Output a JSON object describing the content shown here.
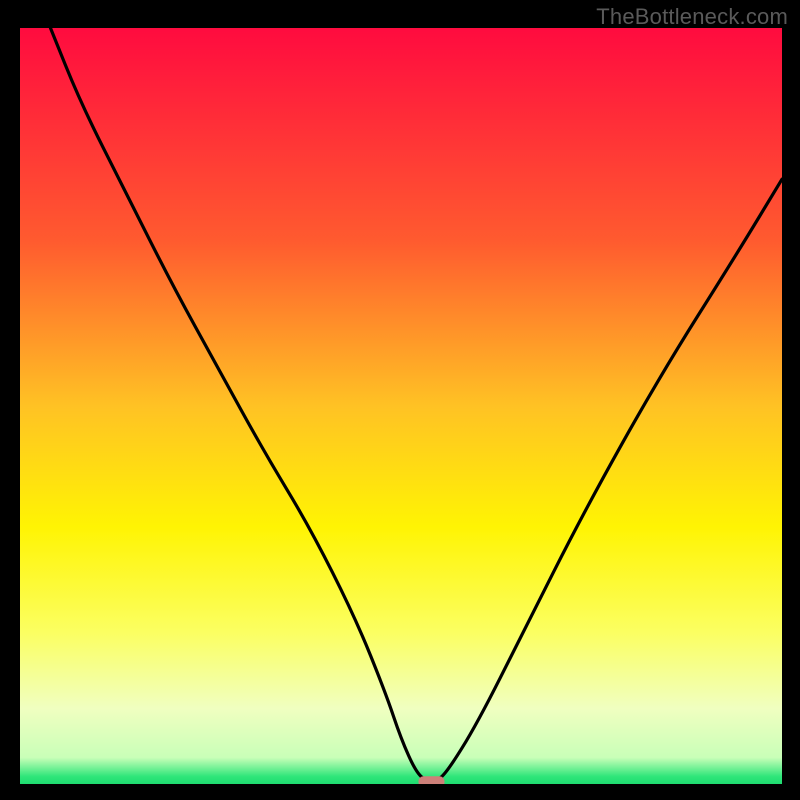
{
  "watermark": "TheBottleneck.com",
  "chart_data": {
    "type": "line",
    "title": "",
    "xlabel": "",
    "ylabel": "",
    "xlim": [
      0,
      100
    ],
    "ylim": [
      0,
      100
    ],
    "gradient_stops": [
      {
        "offset": 0.0,
        "color": "#ff0b3f"
      },
      {
        "offset": 0.28,
        "color": "#ff5a2f"
      },
      {
        "offset": 0.5,
        "color": "#ffc224"
      },
      {
        "offset": 0.66,
        "color": "#fff403"
      },
      {
        "offset": 0.8,
        "color": "#fbff62"
      },
      {
        "offset": 0.9,
        "color": "#f0ffc0"
      },
      {
        "offset": 0.965,
        "color": "#c9ffb8"
      },
      {
        "offset": 0.99,
        "color": "#2fe67a"
      },
      {
        "offset": 1.0,
        "color": "#1fdc70"
      }
    ],
    "series": [
      {
        "name": "bottleneck-curve",
        "x": [
          4,
          8,
          14,
          20,
          26,
          32,
          38,
          44,
          48,
          50,
          52,
          53.5,
          54.5,
          56,
          60,
          66,
          74,
          84,
          94,
          100
        ],
        "y": [
          100,
          90,
          78,
          66,
          55,
          44,
          34,
          22,
          12,
          6,
          1.5,
          0.3,
          0.3,
          1.5,
          8,
          20,
          36,
          54,
          70,
          80
        ]
      }
    ],
    "marker": {
      "x": 54,
      "y": 0.3,
      "shape": "pill",
      "color": "#cd8079"
    }
  }
}
